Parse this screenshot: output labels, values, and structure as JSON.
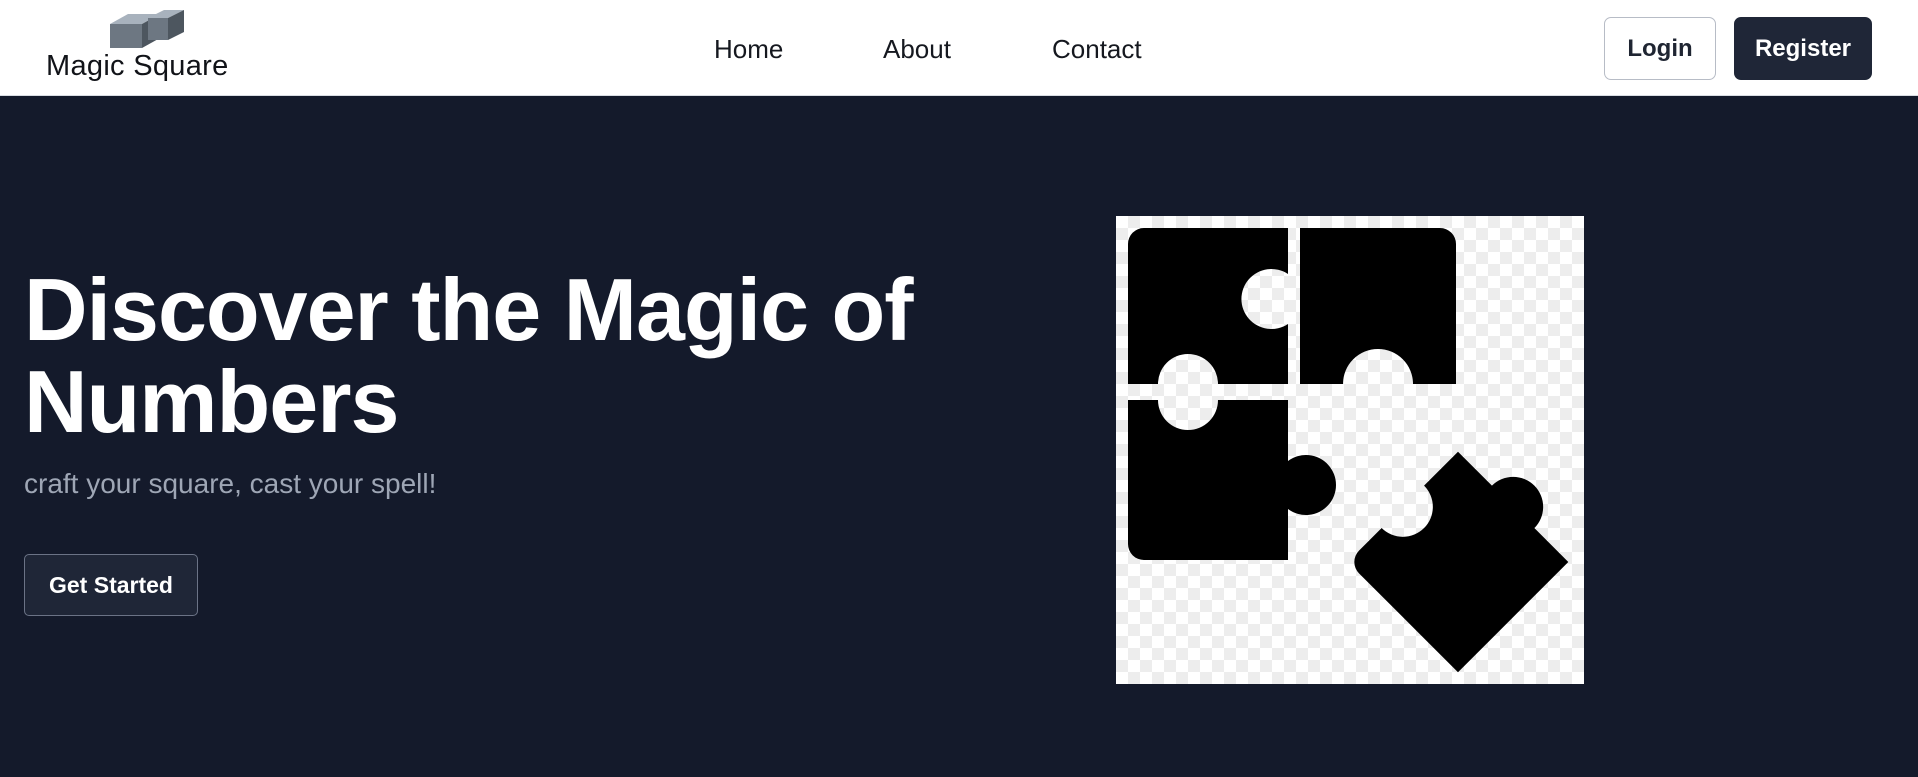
{
  "brand": {
    "name": "Magic Square",
    "logo_icon": "cube-logo-icon"
  },
  "nav": {
    "links": [
      {
        "label": "Home"
      },
      {
        "label": "About"
      },
      {
        "label": "Contact"
      }
    ],
    "login_label": "Login",
    "register_label": "Register"
  },
  "hero": {
    "title": "Discover the Magic of Numbers",
    "subtitle": "craft your square, cast your spell!",
    "cta_label": "Get Started",
    "image_icon": "puzzle-pieces-icon"
  },
  "colors": {
    "hero_background": "#141a2b",
    "primary_button": "#1f2637",
    "subtitle_text": "#9ea6b5"
  }
}
